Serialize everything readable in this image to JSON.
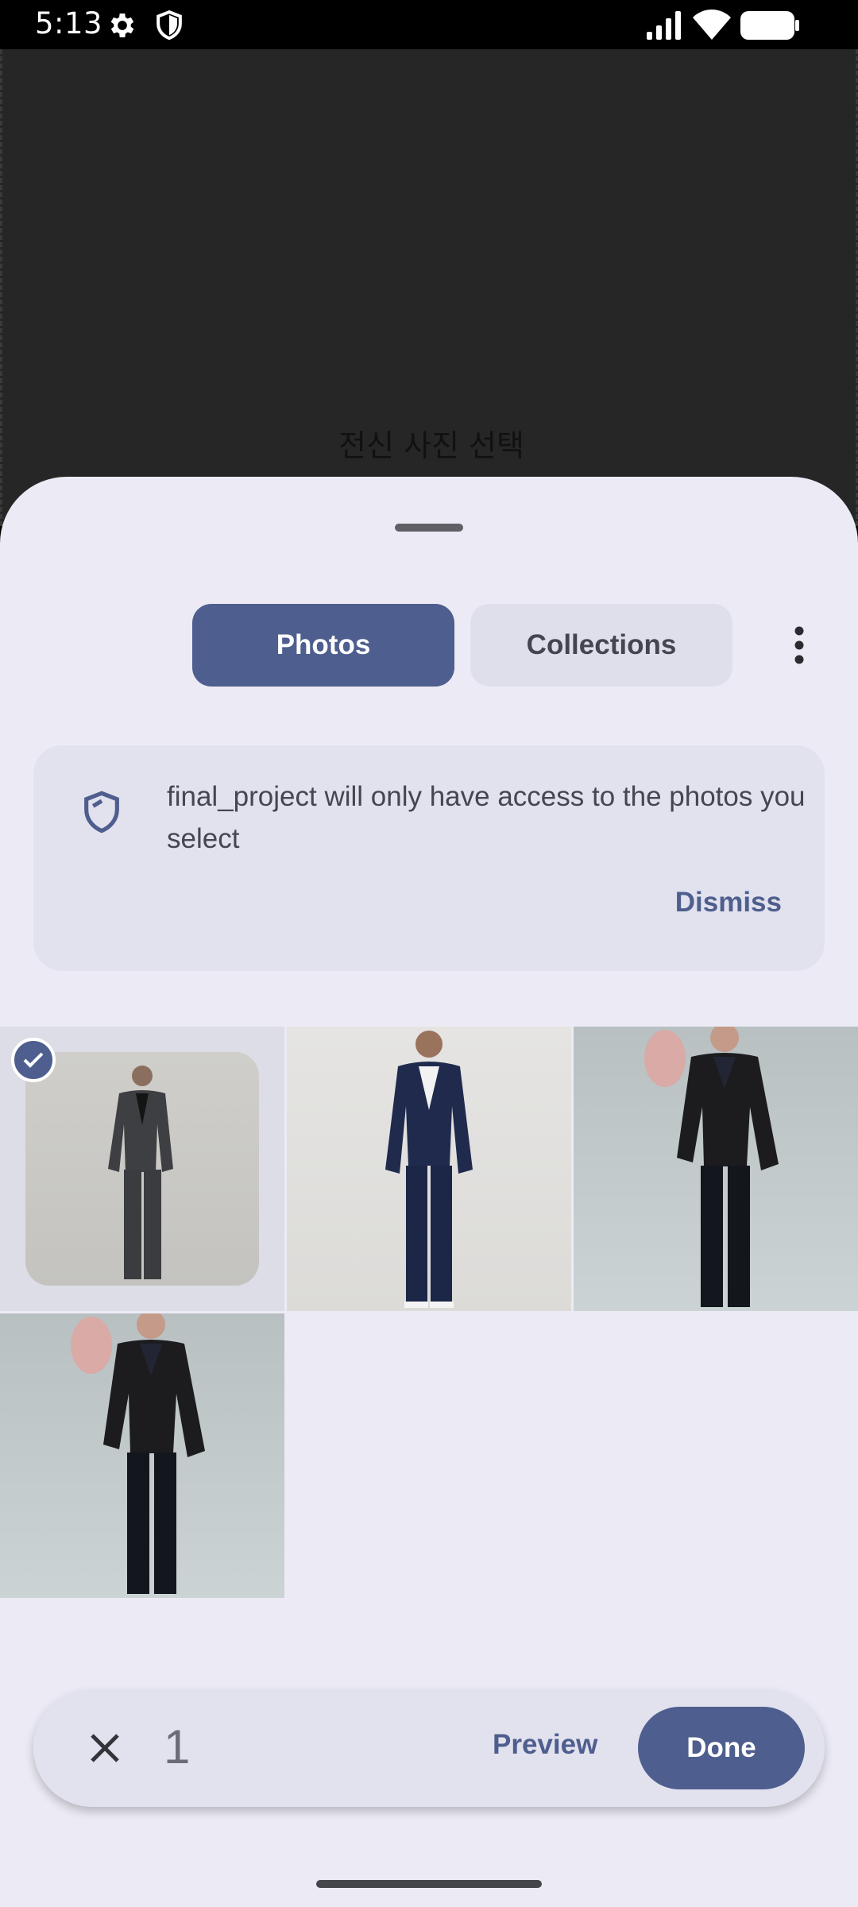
{
  "status_bar": {
    "time": "5:13",
    "icons": [
      "gear-icon",
      "shield-icon",
      "signal-icon",
      "wifi-icon",
      "battery-icon"
    ]
  },
  "background_app": {
    "title": "전신 사진 선택"
  },
  "picker": {
    "tabs": [
      {
        "label": "Photos",
        "selected": true
      },
      {
        "label": "Collections",
        "selected": false
      }
    ],
    "banner": {
      "message": "final_project will only have access to the photos you select",
      "dismiss_label": "Dismiss",
      "icon": "shield-icon"
    },
    "photos": [
      {
        "description": "charcoal suit",
        "selected": true
      },
      {
        "description": "navy suit",
        "selected": false
      },
      {
        "description": "black textured blazer with mask",
        "selected": false
      },
      {
        "description": "black textured blazer with mask",
        "selected": false
      }
    ],
    "action_bar": {
      "selected_count": "1",
      "preview_label": "Preview",
      "done_label": "Done"
    }
  },
  "colors": {
    "accent": "#4e5e8e",
    "sheet_background": "#ecebf5",
    "banner_background": "#e2e2ee"
  }
}
